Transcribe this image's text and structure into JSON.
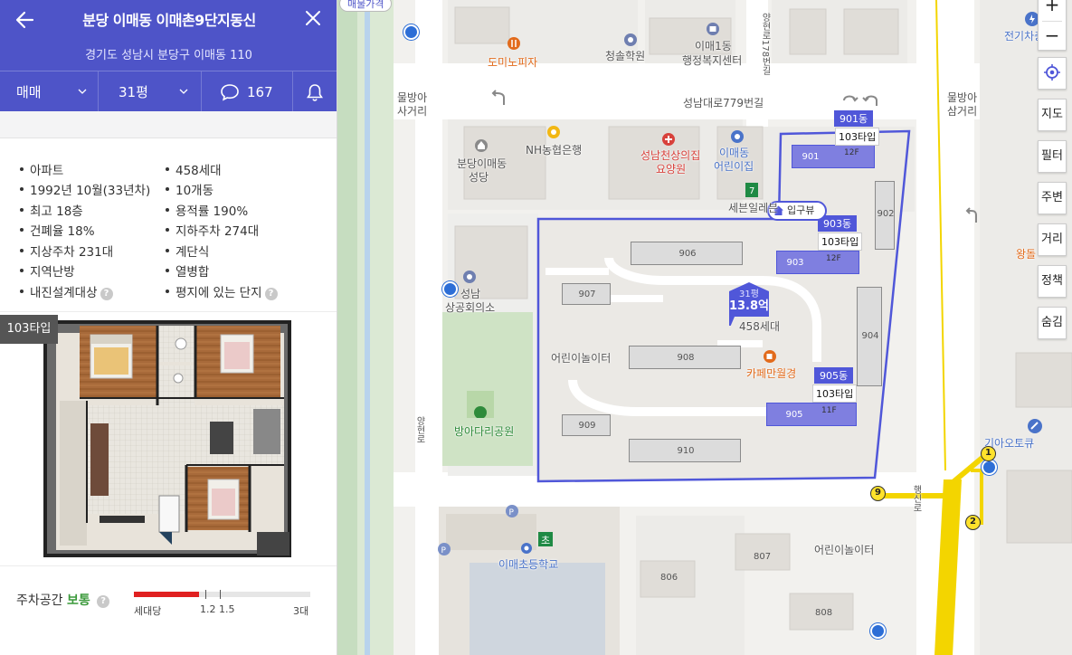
{
  "header": {
    "title": "분당 이매동 이매촌9단지동신",
    "address": "경기도 성남시 분당구 이매동 110",
    "trade_type": "매매",
    "area": "31평",
    "comment_count": "167"
  },
  "facts": [
    "아파트",
    "458세대",
    "1992년 10월(33년차)",
    "10개동",
    "최고 18층",
    "용적률 190%",
    "건폐율 18%",
    "지하주차 274대",
    "지상주차 231대",
    "계단식",
    "지역난방",
    "열병합",
    "내진설계대상",
    "평지에 있는 단지"
  ],
  "floorplan": {
    "type_label": "103타입"
  },
  "parking": {
    "label": "주차공간",
    "level": "보통",
    "value_fraction": 0.37,
    "scale_left": "세대당",
    "scale_marks": "1.2 1.5",
    "scale_right": "3대"
  },
  "map": {
    "top_badge": "매물가격",
    "labels": {
      "domino": "도미노피자",
      "cheongsol": "청솔학원",
      "imae1": "이매1동",
      "imae1b": "행정복지센터",
      "road178": "양현로178번길",
      "seongnam_rd": "성남대로779번길",
      "mulbang_left_a": "물방아",
      "mulbang_left_b": "사거리",
      "mulbang_right_a": "물방아",
      "mulbang_right_b": "삼거리",
      "nh": "NH농협은행",
      "church_a": "분당이매동",
      "church_b": "성당",
      "hospital_a": "성남천상의집",
      "hospital_b": "요양원",
      "kinder_a": "이매동",
      "kinder_b": "어린이집",
      "seven": "세븐일레븐",
      "seongnam_hall_a": "성남",
      "seongnam_hall_b": "상공회의소",
      "playground_in": "어린이놀이터",
      "cafe": "카페만월경",
      "bangadari": "방아다리공원",
      "yanghyeon": "양현로",
      "school": "이매초등학교",
      "playground_out": "어린이놀이터",
      "kia": "기아오토큐",
      "electric": "전기차충",
      "kunsim": "행신로",
      "wangdol": "왕돌"
    },
    "buildings": {
      "b901": "901",
      "b902": "902",
      "b903": "903",
      "b904": "904",
      "b905": "905",
      "b906": "906",
      "b907": "907",
      "b908": "908",
      "b909": "909",
      "b910": "910",
      "b806": "806",
      "b807": "807",
      "b808": "808"
    },
    "dong_tags": {
      "d901": "901동",
      "d903": "903동",
      "d905": "905동"
    },
    "type_tags": {
      "t901": "103타입",
      "t903": "103타입",
      "t905": "103타입"
    },
    "floors": {
      "f901": "12F",
      "f903": "12F",
      "f905": "11F"
    },
    "price_pin": {
      "size": "31평",
      "price": "13.8억",
      "households": "458세대"
    },
    "entrance": "입구뷰",
    "controls": [
      "지도",
      "필터",
      "주변",
      "거리",
      "정책",
      "숨김"
    ],
    "metro": [
      "1",
      "2",
      "9"
    ]
  }
}
